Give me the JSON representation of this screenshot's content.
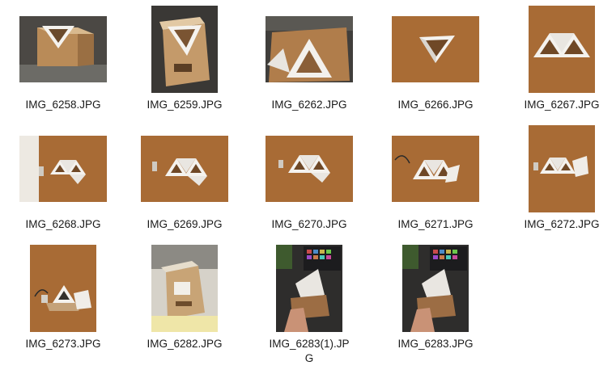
{
  "files": [
    {
      "name": "IMG_6258.JPG"
    },
    {
      "name": "IMG_6259.JPG"
    },
    {
      "name": "IMG_6262.JPG"
    },
    {
      "name": "IMG_6266.JPG"
    },
    {
      "name": "IMG_6267.JPG"
    },
    {
      "name": "IMG_6268.JPG"
    },
    {
      "name": "IMG_6269.JPG"
    },
    {
      "name": "IMG_6270.JPG"
    },
    {
      "name": "IMG_6271.JPG"
    },
    {
      "name": "IMG_6272.JPG"
    },
    {
      "name": "IMG_6273.JPG"
    },
    {
      "name": "IMG_6282.JPG"
    },
    {
      "name": "IMG_6283(1).JPG"
    },
    {
      "name": "IMG_6283.JPG"
    }
  ]
}
